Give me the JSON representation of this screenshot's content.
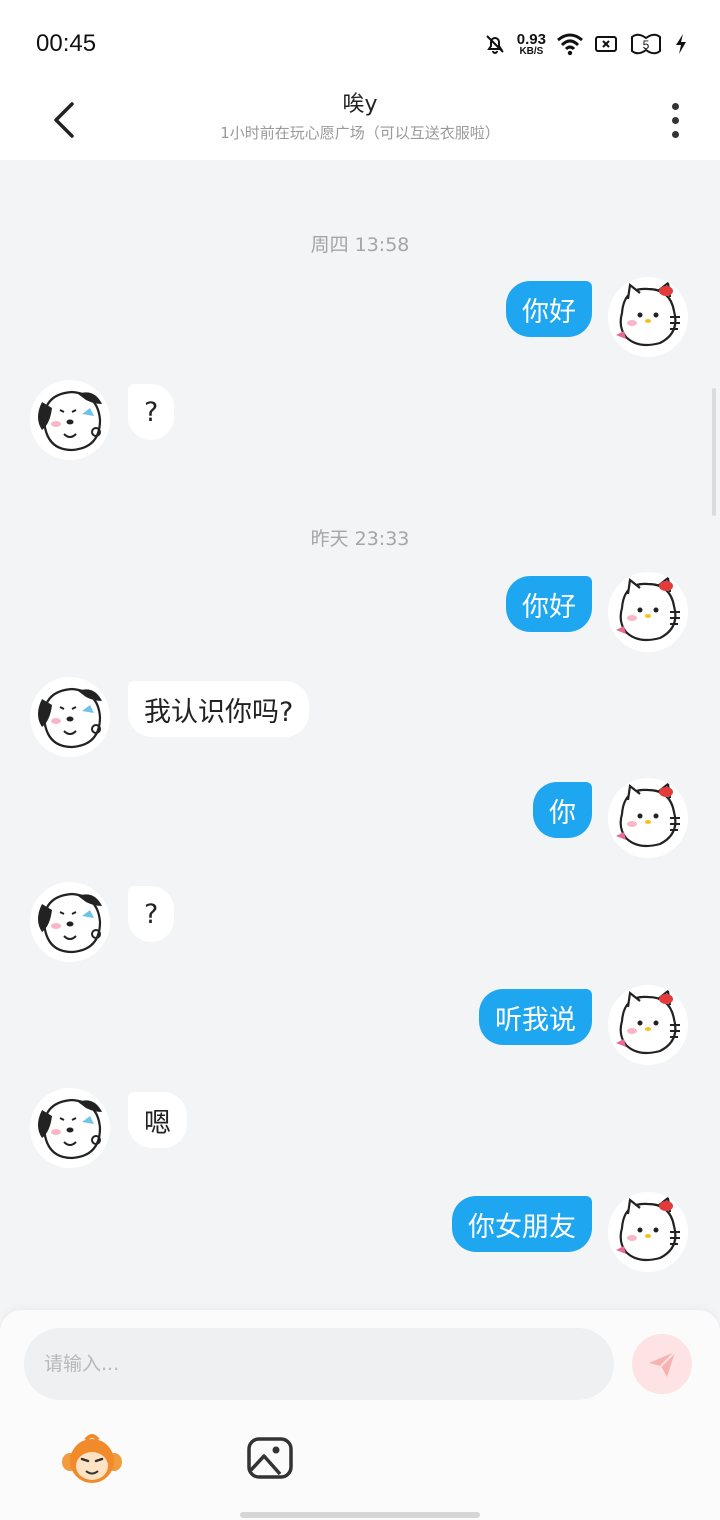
{
  "status_bar": {
    "time": "00:45",
    "net_speed_value": "0.93",
    "net_speed_unit": "KB/S",
    "battery_level": "5",
    "icons": [
      "mute-icon",
      "wifi-icon",
      "sim-icon",
      "battery-icon",
      "charging-icon"
    ]
  },
  "header": {
    "title": "唉y",
    "subtitle": "1小时前在玩心愿广场（可以互送衣服啦）"
  },
  "messages": [
    {
      "type": "timestamp",
      "text": "周四 13:58"
    },
    {
      "type": "msg",
      "from": "me",
      "text": "你好"
    },
    {
      "type": "msg",
      "from": "them",
      "text": "?"
    },
    {
      "type": "timestamp",
      "text": "昨天 23:33"
    },
    {
      "type": "msg",
      "from": "me",
      "text": "你好"
    },
    {
      "type": "msg",
      "from": "them",
      "text": "我认识你吗?"
    },
    {
      "type": "msg",
      "from": "me",
      "text": "你"
    },
    {
      "type": "msg",
      "from": "them",
      "text": "?"
    },
    {
      "type": "msg",
      "from": "me",
      "text": "听我说"
    },
    {
      "type": "msg",
      "from": "them",
      "text": "嗯"
    },
    {
      "type": "msg",
      "from": "me",
      "text": "你女朋友"
    }
  ],
  "input": {
    "placeholder": "请输入..."
  },
  "colors": {
    "my_bubble": "#1fa6f1",
    "their_bubble": "#ffffff",
    "chat_background": "#f2f4f6",
    "send_button": "#fde3e3"
  }
}
